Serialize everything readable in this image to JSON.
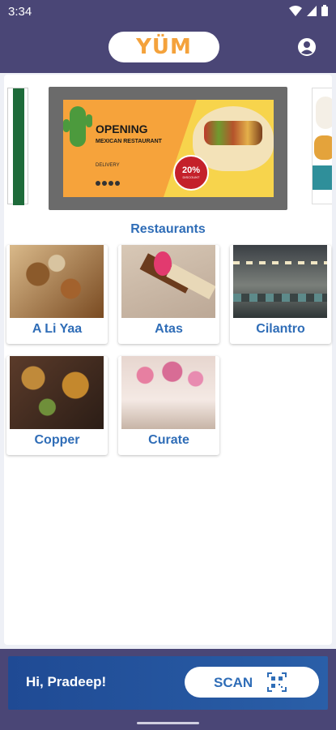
{
  "status_bar": {
    "time": "3:34"
  },
  "app_bar": {
    "logo": "YÜM",
    "account_icon": "account-circle-icon"
  },
  "carousel": {
    "banner": {
      "headline": "OPENING",
      "subline": "MEXICAN RESTAURANT",
      "delivery": "DELIVERY",
      "discount_value": "20%",
      "discount_label": "DISCOUNT"
    }
  },
  "restaurants": {
    "title": "Restaurants",
    "items": [
      {
        "name": "A Li Yaa"
      },
      {
        "name": "Atas"
      },
      {
        "name": "Cilantro"
      },
      {
        "name": "Copper"
      },
      {
        "name": "Curate"
      }
    ]
  },
  "footer": {
    "greeting": "Hi, Pradeep!",
    "scan_label": "SCAN",
    "scan_icon": "qr-scan-icon"
  },
  "colors": {
    "system_bar": "#4a4676",
    "accent_blue": "#2f6db7",
    "footer_blue": "#1f4a94",
    "logo_orange": "#f4a23c"
  }
}
